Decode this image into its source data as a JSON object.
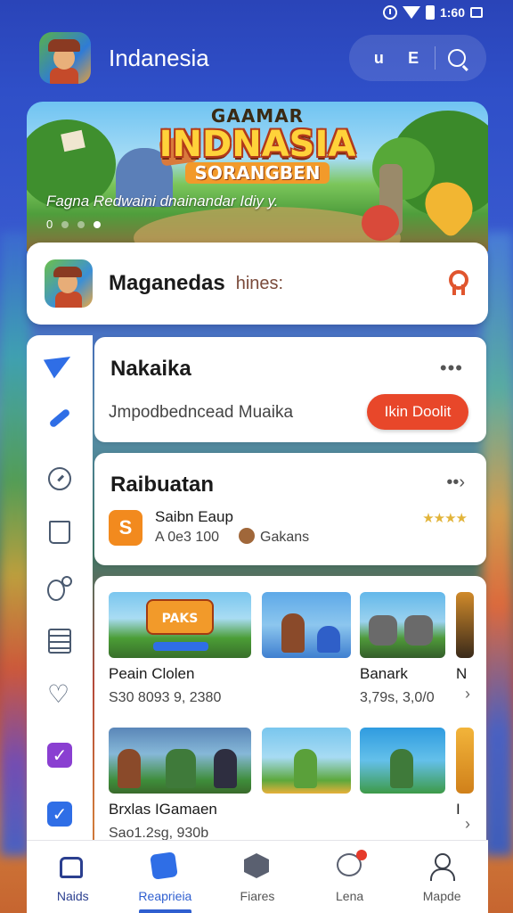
{
  "status_bar": {
    "time": "1:60"
  },
  "header": {
    "title": "Indanesia",
    "action_u": "u",
    "action_e": "E"
  },
  "hero": {
    "pre_title": "GAAMAR",
    "title": "INDNASIA",
    "subtitle": "SORANGBEN",
    "caption": "Fagna Redwaini dnainandar Idiy y.",
    "slide_label": "0"
  },
  "featured": {
    "title": "Maganedas",
    "subtitle": "hines:"
  },
  "section_one": {
    "title": "Nakaika",
    "more": "•••",
    "subtitle": "Jmpodbedncead Muaika",
    "action_label": "Ikin Doolit"
  },
  "section_two": {
    "title": "Raibuatan",
    "more": "••›",
    "item_name": "Saibn Eaup",
    "item_meta": "A 0e3 100",
    "item_category": "Gakans",
    "stars": "★★★★"
  },
  "grid": {
    "tiles": [
      {
        "name": "Peain Clolen",
        "meta": "S30 8093 9, 2380",
        "logo": "PAKS"
      },
      {
        "name": "",
        "meta": ""
      },
      {
        "name": "Banark",
        "meta": "3,79s, 3,0/0"
      },
      {
        "name": "N",
        "meta": ""
      },
      {
        "name": "Brxlas IGamaen",
        "meta": "Sao1.2sg, 930b"
      },
      {
        "name": "",
        "meta": ""
      },
      {
        "name": "",
        "meta": ""
      },
      {
        "name": "I",
        "meta": ""
      }
    ],
    "chevron": "›"
  },
  "bottom_nav": [
    {
      "label": "Naids"
    },
    {
      "label": "Reaprieia"
    },
    {
      "label": "Fiares"
    },
    {
      "label": "Lena"
    },
    {
      "label": "Mapde"
    }
  ],
  "colors": {
    "accent": "#2f5fd0",
    "action": "#e8472a",
    "background": "#2f4fc8"
  }
}
